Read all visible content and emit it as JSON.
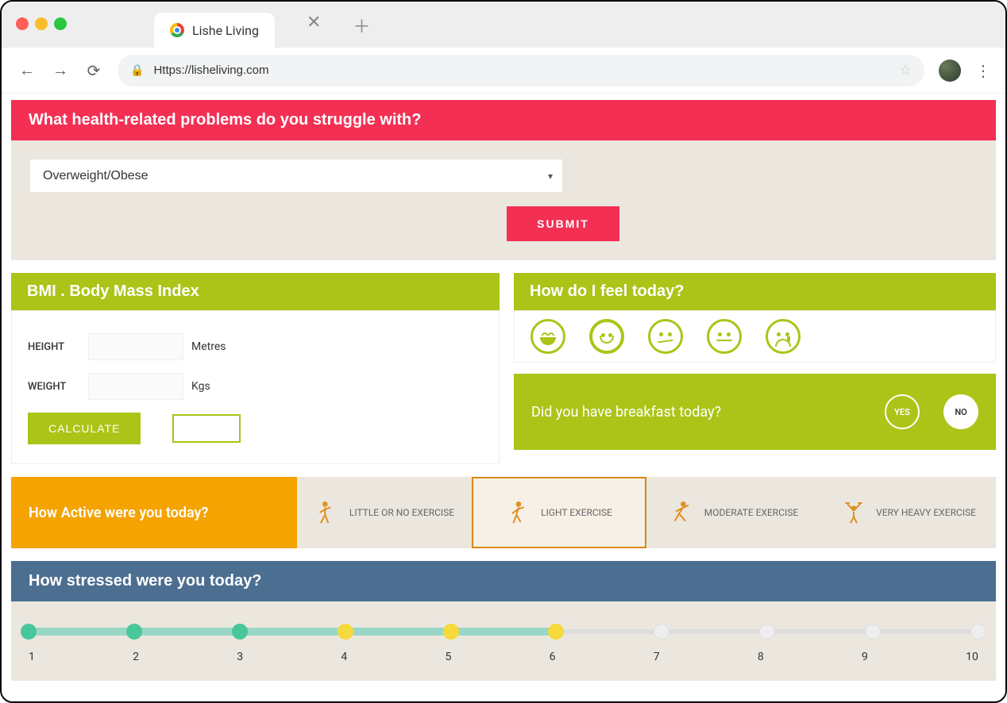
{
  "browser": {
    "tab_title": "Lishe Living",
    "url": "Https://lisheliving.com"
  },
  "health_problems": {
    "heading": "What health-related problems do you struggle with?",
    "selected": "Overweight/Obese",
    "submit_label": "SUBMIT"
  },
  "bmi": {
    "heading": "BMI . Body Mass Index",
    "height_label": "HEIGHT",
    "height_unit": "Metres",
    "weight_label": "WEIGHT",
    "weight_unit": "Kgs",
    "calculate_label": "CALCULATE"
  },
  "feel": {
    "heading": "How do I feel today?",
    "moods": [
      "laugh",
      "happy",
      "meh",
      "neutral",
      "sad"
    ],
    "selected_index": 1
  },
  "breakfast": {
    "question": "Did you have breakfast today?",
    "yes_label": "YES",
    "no_label": "NO"
  },
  "activity": {
    "heading": "How Active were you today?",
    "options": [
      "LITTLE OR NO EXERCISE",
      "LIGHT  EXERCISE",
      "MODERATE  EXERCISE",
      "VERY HEAVY  EXERCISE"
    ],
    "selected_index": 1
  },
  "stress": {
    "heading": "How stressed were you today?",
    "min": 1,
    "max": 10,
    "value": 6,
    "labels": [
      "1",
      "2",
      "3",
      "4",
      "5",
      "6",
      "7",
      "8",
      "9",
      "10"
    ],
    "dot_colors": [
      "green",
      "green",
      "green",
      "yellow",
      "yellow",
      "yellow",
      "grey",
      "grey",
      "grey",
      "grey"
    ]
  }
}
